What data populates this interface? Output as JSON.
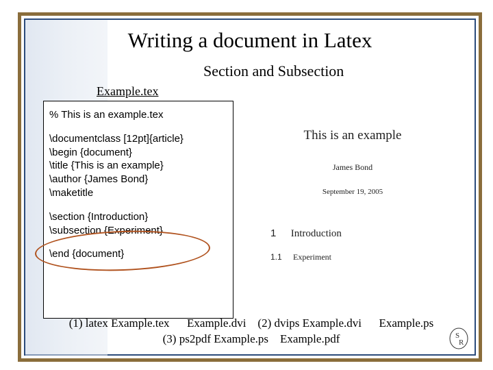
{
  "title": "Writing a document in Latex",
  "subtitle": "Section and Subsection",
  "example_label": "Example.tex",
  "code": {
    "comment": "% This is an example.tex",
    "l1": "\\documentclass [12pt]{article}",
    "l2": "\\begin {document}",
    "l3": "\\title {This is an example}",
    "l4": "\\author {James Bond}",
    "l5": "\\maketitle",
    "l6": "\\section {Introduction}",
    "l7": "\\subsection {Experiment}",
    "l8": "\\end {document}"
  },
  "output": {
    "title": "This is an example",
    "author": "James Bond",
    "date": "September 19, 2005",
    "sec_num": "1",
    "sec_name": "Introduction",
    "subsec_num": "1.1",
    "subsec_name": "Experiment"
  },
  "steps": {
    "line1": "(1) latex Example.tex      Example.dvi    (2) dvips Example.dvi      Example.ps",
    "line2": "(3) ps2pdf Example.ps    Example.pdf"
  }
}
